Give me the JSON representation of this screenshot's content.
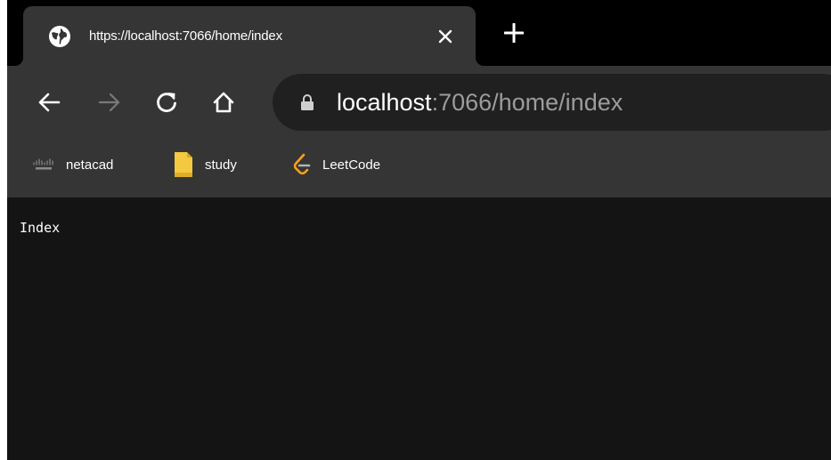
{
  "tab": {
    "title": "https://localhost:7066/home/index",
    "favicon": "globe-icon",
    "close_icon": "close-icon"
  },
  "new_tab_icon": "plus-icon",
  "toolbar": {
    "back_icon": "arrow-left-icon",
    "forward_icon": "arrow-right-icon",
    "reload_icon": "reload-icon",
    "home_icon": "home-icon",
    "lock_icon": "lock-icon"
  },
  "address_bar": {
    "host": "localhost",
    "rest": ":7066/home/index"
  },
  "bookmarks": [
    {
      "label": "netacad",
      "icon": "cisco-icon"
    },
    {
      "label": "study",
      "icon": "folder-icon"
    },
    {
      "label": "LeetCode",
      "icon": "leetcode-icon"
    }
  ],
  "page": {
    "text": "Index"
  },
  "colors": {
    "tabstrip": "#000000",
    "toolbar": "#353535",
    "omnibox": "#202020",
    "content": "#141414",
    "folder": "#f5c842",
    "leetcode": "#ffa116"
  }
}
